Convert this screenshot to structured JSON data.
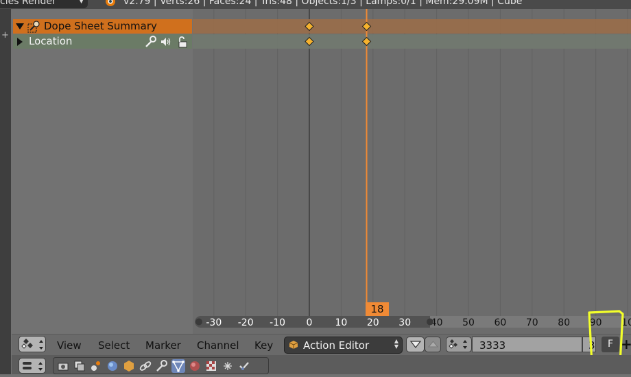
{
  "top_bar": {
    "render_engine": "cles Render",
    "stats": "v2.79 | Verts:26 | Faces:24 | Tris:48 | Objects:1/3 | Lamps:0/1 | Mem:29.09M | Cube"
  },
  "channels": {
    "summary_label": "Dope Sheet Summary",
    "location_label": "Location"
  },
  "timeline": {
    "current_frame": "18",
    "ruler_labels": [
      "-30",
      "-20",
      "-10",
      "0",
      "10",
      "20",
      "30",
      "40",
      "50",
      "60",
      "70",
      "80",
      "90",
      "10"
    ],
    "keyframes": [
      0,
      18
    ]
  },
  "header": {
    "menus": [
      "View",
      "Select",
      "Marker",
      "Channel",
      "Key"
    ],
    "mode": "Action Editor",
    "action_name": "3333",
    "users": "3",
    "fake_user": "F",
    "add_label": "+"
  },
  "colors": {
    "summary_row": "#d0701d",
    "location_row": "#6b7b66",
    "playhead": "#f08a35",
    "keyframe": "#f5b22e",
    "highlight": "#f3ff2a"
  }
}
